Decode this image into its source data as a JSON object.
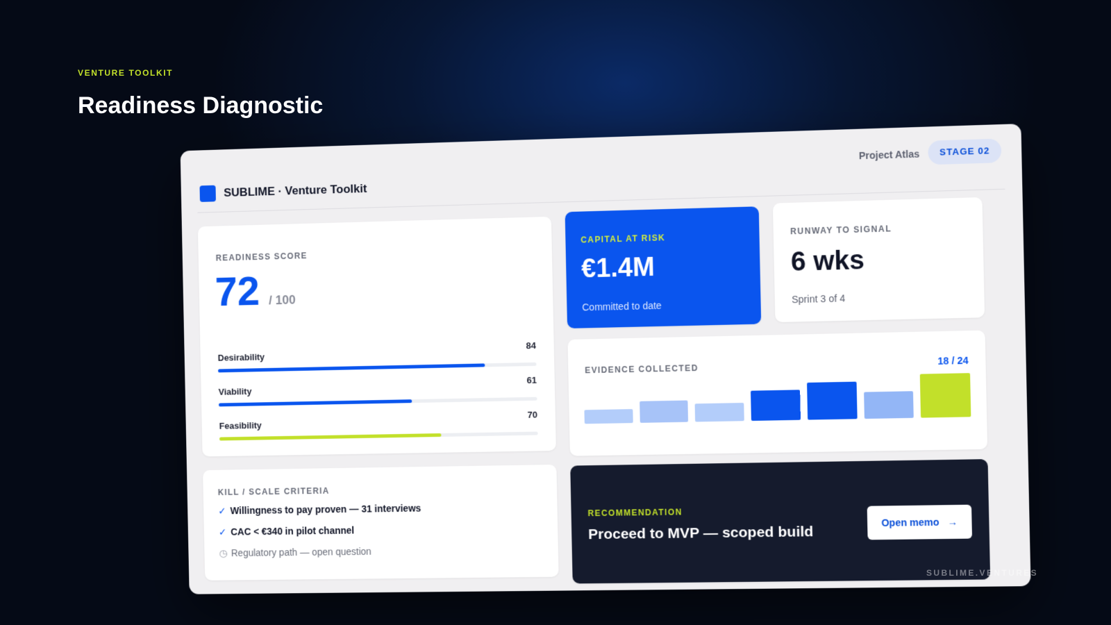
{
  "hero": {
    "eyebrow": "VENTURE TOOLKIT",
    "title": "Readiness Diagnostic"
  },
  "footer": {
    "brand": "SUBLIME.VENTURES"
  },
  "app": {
    "name": "SUBLIME · Venture Toolkit",
    "project": "Project Atlas",
    "stage": "STAGE 02",
    "brand_color": "#0a55ee",
    "accent_color": "#c2e02a"
  },
  "readiness": {
    "label": "READINESS SCORE",
    "score": "72",
    "max": "/ 100",
    "metrics": [
      {
        "name": "Desirability",
        "value": "84",
        "level": 0.84,
        "color": "#0a55ee"
      },
      {
        "name": "Viability",
        "value": "61",
        "level": 0.61,
        "color": "#0a55ee"
      },
      {
        "name": "Feasibility",
        "value": "70",
        "level": 0.7,
        "color": "#c2e02a"
      }
    ]
  },
  "capital": {
    "label": "CAPITAL AT RISK",
    "value": "€1.4M",
    "sub": "Committed to date"
  },
  "runway": {
    "label": "RUNWAY TO SIGNAL",
    "value": "6 wks",
    "sub": "Sprint 3 of 4"
  },
  "evidence": {
    "label": "EVIDENCE COLLECTED",
    "count": "18 / 24",
    "bars": [
      {
        "level": 0.33,
        "color": "#b3cdfa"
      },
      {
        "level": 0.5,
        "color": "#a7c3f8"
      },
      {
        "level": 0.42,
        "color": "#b3cdfa"
      },
      {
        "level": 0.69,
        "color": "#0a55ee"
      },
      {
        "level": 0.85,
        "color": "#0a55ee"
      },
      {
        "level": 0.62,
        "color": "#93b6f6"
      },
      {
        "level": 1.0,
        "color": "#c2e02a"
      }
    ]
  },
  "criteria": {
    "label": "KILL / SCALE CRITERIA",
    "items": [
      {
        "text": "Willingness to pay proven — 31 interviews",
        "icon": "check-icon",
        "status": "done"
      },
      {
        "text": "CAC < €340 in pilot channel",
        "icon": "check-icon",
        "status": "done"
      },
      {
        "text": "Regulatory path — open question",
        "icon": "clock-icon",
        "status": "open"
      }
    ]
  },
  "recommendation": {
    "label": "RECOMMENDATION",
    "text": "Proceed to MVP — scoped build",
    "button": "Open memo",
    "button_icon": "arrow-right-icon"
  }
}
